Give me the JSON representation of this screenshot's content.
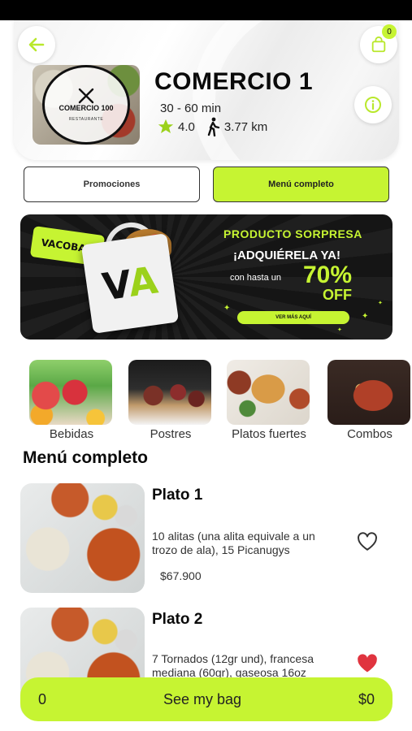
{
  "header": {
    "store_name": "COMERCIO 1",
    "delivery_time": "30 - 60 min",
    "rating": "4.0",
    "distance": "3.77 km",
    "bag_count": "0",
    "logo": {
      "name": "COMERCIO 100",
      "sub": "RESTAURANTE"
    }
  },
  "tabs": {
    "promotions": "Promociones",
    "full_menu": "Menú completo"
  },
  "banner": {
    "tag": "VACOBAG",
    "title": "PRODUCTO SORPRESA",
    "subtitle": "¡ADQUIÉRELA YA!",
    "prefix": "con hasta un",
    "percent": "70%",
    "off": "OFF",
    "cta": "VER MÁS AQUÍ"
  },
  "categories": [
    {
      "label": "Bebidas"
    },
    {
      "label": "Postres"
    },
    {
      "label": "Platos fuertes"
    },
    {
      "label": "Combos"
    }
  ],
  "section_title": "Menú completo",
  "items": [
    {
      "name": "Plato 1",
      "description": "10 alitas (una alita equivale a un trozo de ala), 15 Picanugys",
      "price": "$67.900",
      "favorite": false
    },
    {
      "name": "Plato 2",
      "description": "7 Tornados (12gr und), francesa mediana (60gr), gaseosa 16oz",
      "price": "",
      "favorite": true
    }
  ],
  "bag_bar": {
    "count": "0",
    "label": "See my bag",
    "total": "$0"
  },
  "colors": {
    "accent": "#c6f432",
    "favorite": "#e0343f",
    "dark": "#0a0a0a"
  }
}
